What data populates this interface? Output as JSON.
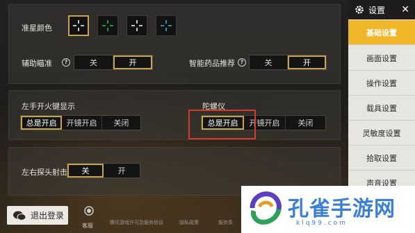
{
  "reticle_color": {
    "label": "准星颜色",
    "swatches": [
      {
        "name": "white",
        "color": "#ffffff",
        "selected": true
      },
      {
        "name": "green",
        "color": "#2fbf4a",
        "selected": false
      },
      {
        "name": "white",
        "color": "#ffffff",
        "selected": false
      },
      {
        "name": "cyan",
        "color": "#3ab7d6",
        "selected": false
      }
    ]
  },
  "aim_assist": {
    "label": "辅助瞄准",
    "off": "关",
    "on": "开"
  },
  "smart_meds": {
    "label": "智能药品推荐",
    "off": "关",
    "on": "开"
  },
  "left_fire": {
    "label": "左手开火键显示",
    "options": [
      "总是开启",
      "开镜开启",
      "关闭"
    ]
  },
  "gyroscope": {
    "label": "陀螺仪",
    "options": [
      "总是开启",
      "开镜开启",
      "关闭"
    ]
  },
  "peek_fire": {
    "label": "左右探头射击",
    "off": "关",
    "on": "开"
  },
  "sidebar": {
    "title": "设置",
    "close": "✕",
    "items": [
      {
        "label": "基础设置",
        "active": true
      },
      {
        "label": "画面设置",
        "active": false
      },
      {
        "label": "操作设置",
        "active": false
      },
      {
        "label": "载具设置",
        "active": false
      },
      {
        "label": "灵敏度设置",
        "active": false
      },
      {
        "label": "拾取设置",
        "active": false
      },
      {
        "label": "声音设置",
        "active": false
      }
    ]
  },
  "footer": {
    "logout": "退出登录",
    "service": "客服",
    "links": [
      "腾讯游戏许可及服务协议",
      "隐私政策",
      "服务条"
    ]
  },
  "watermark": {
    "text": "孔雀手游网",
    "url": "klq99.com"
  }
}
